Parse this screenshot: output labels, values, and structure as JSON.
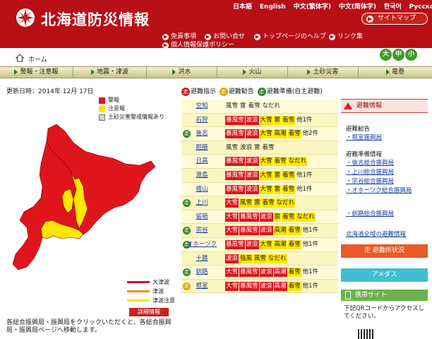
{
  "header": {
    "title": "北海道防災情報",
    "languages": [
      "日本語",
      "English",
      "中文(繁体字)",
      "中文(简体字)",
      "한국어",
      "Русско"
    ],
    "sitemap_label": "サイトマップ",
    "links": [
      "免責事項",
      "お問い合せ",
      "トップページのヘルプ",
      "リンク集",
      "個人情報保護ポリシー"
    ]
  },
  "home": {
    "label": "ホーム",
    "sizes": [
      "大",
      "中",
      "小"
    ]
  },
  "nav": [
    "警報・注意報",
    "地震・津波",
    "洪水",
    "火山",
    "土砂災害",
    "竜巻"
  ],
  "update": "更新日時：2014年 12月 17日",
  "legend": [
    {
      "label": "警報",
      "color": "#e0151c"
    },
    {
      "label": "注意報",
      "color": "#ffe600"
    },
    {
      "label": "土砂災害警戒情報あり",
      "color": "#ffffff"
    }
  ],
  "tsunami_legend": [
    {
      "label": "大津波",
      "color": "#c8102e"
    },
    {
      "label": "津波",
      "color": "#f28c28"
    },
    {
      "label": "津波注意",
      "color": "#ffe600"
    }
  ],
  "detail_label": "詳細情報",
  "note": "各総合振興局・振興局をクリックいただくと、各総合振興局・振興局ページへ移動します。",
  "evac_key": [
    {
      "icon": "走",
      "label": "避難指示",
      "color": "#c81e1e"
    },
    {
      "icon": "走",
      "label": "避難勧告",
      "color": "#e6a400"
    },
    {
      "icon": "走",
      "label": "避難準備(自主避難)",
      "color": "#2c8a2c"
    }
  ],
  "regions": [
    {
      "name": "空知",
      "icon": "",
      "warnings": [
        {
          "t": "風雪",
          "k": "n"
        },
        {
          "t": "雷",
          "k": "n"
        },
        {
          "t": "着雪",
          "k": "n"
        },
        {
          "t": "なだれ",
          "k": "n"
        }
      ]
    },
    {
      "name": "石狩",
      "icon": "",
      "warnings": [
        {
          "t": "暴風雪",
          "k": "r"
        },
        {
          "t": "波浪",
          "k": "r"
        },
        {
          "t": "大雪",
          "k": "y"
        },
        {
          "t": "雷",
          "k": "y"
        },
        {
          "t": "着雪",
          "k": "y"
        },
        {
          "t": "他1件",
          "k": "n"
        }
      ]
    },
    {
      "name": "後志",
      "icon": "g",
      "warnings": [
        {
          "t": "暴風雪",
          "k": "r"
        },
        {
          "t": "波浪",
          "k": "r"
        },
        {
          "t": "大雪",
          "k": "y"
        },
        {
          "t": "高潮",
          "k": "y"
        },
        {
          "t": "着雪",
          "k": "y"
        },
        {
          "t": "他2件",
          "k": "n"
        }
      ]
    },
    {
      "name": "胆振",
      "icon": "",
      "warnings": [
        {
          "t": "風雪",
          "k": "n"
        },
        {
          "t": "波浪",
          "k": "n"
        },
        {
          "t": "雷",
          "k": "n"
        },
        {
          "t": "着雪",
          "k": "n"
        }
      ]
    },
    {
      "name": "日高",
      "icon": "",
      "warnings": [
        {
          "t": "暴風雪",
          "k": "r"
        },
        {
          "t": "波浪",
          "k": "r"
        },
        {
          "t": "大雪",
          "k": "y"
        },
        {
          "t": "着雪",
          "k": "y"
        },
        {
          "t": "なだれ",
          "k": "y"
        }
      ]
    },
    {
      "name": "渡島",
      "icon": "",
      "warnings": [
        {
          "t": "暴風雪",
          "k": "r"
        },
        {
          "t": "波浪",
          "k": "r"
        },
        {
          "t": "大雪",
          "k": "y"
        },
        {
          "t": "雷",
          "k": "y"
        },
        {
          "t": "着雪",
          "k": "y"
        },
        {
          "t": "他1件",
          "k": "n"
        }
      ]
    },
    {
      "name": "檜山",
      "icon": "",
      "warnings": [
        {
          "t": "暴風雪",
          "k": "r"
        },
        {
          "t": "波浪",
          "k": "r"
        },
        {
          "t": "大雪",
          "k": "y"
        },
        {
          "t": "雷",
          "k": "y"
        },
        {
          "t": "着雪",
          "k": "y"
        },
        {
          "t": "他1件",
          "k": "n"
        }
      ]
    },
    {
      "name": "上川",
      "icon": "g",
      "warnings": [
        {
          "t": "大雪",
          "k": "r"
        },
        {
          "t": "風雪",
          "k": "y"
        },
        {
          "t": "雷",
          "k": "y"
        },
        {
          "t": "着雪",
          "k": "y"
        },
        {
          "t": "なだれ",
          "k": "y"
        }
      ]
    },
    {
      "name": "留萌",
      "icon": "",
      "warnings": [
        {
          "t": "大雪",
          "k": "r"
        },
        {
          "t": "暴風雪",
          "k": "r"
        },
        {
          "t": "波浪",
          "k": "r"
        },
        {
          "t": "雷",
          "k": "y"
        },
        {
          "t": "着雪",
          "k": "y"
        },
        {
          "t": "なだれ",
          "k": "y"
        }
      ]
    },
    {
      "name": "宗谷",
      "icon": "g",
      "warnings": [
        {
          "t": "大雪",
          "k": "r"
        },
        {
          "t": "暴風雪",
          "k": "r"
        },
        {
          "t": "波浪",
          "k": "r"
        },
        {
          "t": "高潮",
          "k": "y"
        },
        {
          "t": "着雪",
          "k": "y"
        },
        {
          "t": "他1件",
          "k": "n"
        }
      ]
    },
    {
      "name": "オホーツク",
      "icon": "g",
      "warnings": [
        {
          "t": "暴風雪",
          "k": "r"
        },
        {
          "t": "波浪",
          "k": "r"
        },
        {
          "t": "大雪",
          "k": "y"
        },
        {
          "t": "高潮",
          "k": "y"
        },
        {
          "t": "着雪",
          "k": "y"
        },
        {
          "t": "他1件",
          "k": "n"
        }
      ]
    },
    {
      "name": "十勝",
      "icon": "",
      "warnings": [
        {
          "t": "波浪",
          "k": "r"
        },
        {
          "t": "強風",
          "k": "y"
        },
        {
          "t": "風雪",
          "k": "y"
        },
        {
          "t": "なだれ",
          "k": "y"
        }
      ]
    },
    {
      "name": "釧路",
      "icon": "g",
      "warnings": [
        {
          "t": "大雪",
          "k": "r"
        },
        {
          "t": "暴風雪",
          "k": "r"
        },
        {
          "t": "波浪",
          "k": "r"
        },
        {
          "t": "高潮",
          "k": "r"
        },
        {
          "t": "着雪",
          "k": "y"
        },
        {
          "t": "他1件",
          "k": "n"
        }
      ]
    },
    {
      "name": "根室",
      "icon": "o",
      "warnings": [
        {
          "t": "大雪",
          "k": "r"
        },
        {
          "t": "暴風雪",
          "k": "r"
        },
        {
          "t": "波浪",
          "k": "r"
        },
        {
          "t": "高潮",
          "k": "r"
        },
        {
          "t": "着雪",
          "k": "y"
        },
        {
          "t": "他1件",
          "k": "n"
        }
      ]
    }
  ],
  "sidebar": {
    "evac_title": "避難情報",
    "kankoku_title": "避難勧告",
    "kankoku_items": [
      "・根室振興局"
    ],
    "junbi_title": "避難準備情報",
    "junbi_items": [
      "・後志総合振興局",
      "・上川総合振興局",
      "・宗谷総合振興局",
      "・オホーツク総合振興局",
      "・釧路総合振興局"
    ],
    "all_evac": "北海道全域の避難情報",
    "shelter": "避難所状況",
    "amedas": "アメダス",
    "mobile": "携帯サイト",
    "qr_text": "下記QRコードからアクセスしてください。"
  }
}
